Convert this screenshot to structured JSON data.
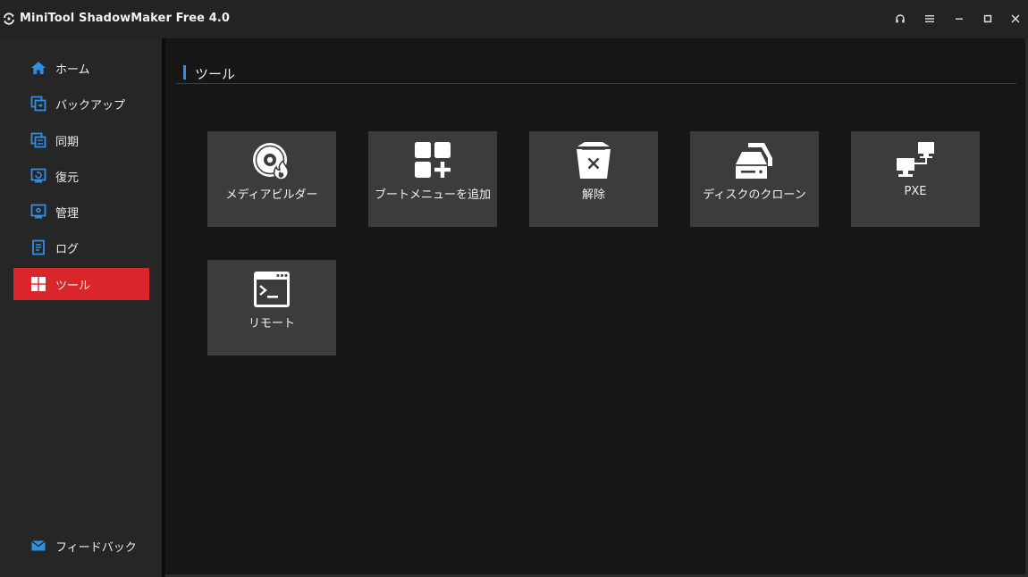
{
  "window": {
    "title": "MiniTool ShadowMaker Free 4.0"
  },
  "sidebar": {
    "items": [
      {
        "label": "ホーム",
        "icon": "home-icon"
      },
      {
        "label": "バックアップ",
        "icon": "backup-icon"
      },
      {
        "label": "同期",
        "icon": "sync-icon"
      },
      {
        "label": "復元",
        "icon": "restore-icon"
      },
      {
        "label": "管理",
        "icon": "manage-icon"
      },
      {
        "label": "ログ",
        "icon": "log-icon"
      },
      {
        "label": "ツール",
        "icon": "tools-icon",
        "active": true
      }
    ],
    "feedback": {
      "label": "フィードバック",
      "icon": "mail-icon"
    }
  },
  "main": {
    "title": "ツール",
    "tools": [
      {
        "label": "メディアビルダー",
        "icon": "media-builder-icon"
      },
      {
        "label": "ブートメニューを追加",
        "icon": "add-boot-menu-icon"
      },
      {
        "label": "解除",
        "icon": "unmount-icon"
      },
      {
        "label": "ディスクのクローン",
        "icon": "clone-disk-icon"
      },
      {
        "label": "PXE",
        "icon": "pxe-network-icon"
      },
      {
        "label": "リモート",
        "icon": "remote-terminal-icon"
      }
    ]
  },
  "colors": {
    "accent": "#d9262b",
    "nav_icon": "#2f8ee6",
    "section_marker": "#2f8ee6",
    "tile_bg": "#3c3c3c",
    "background": "#161616",
    "sidebar_bg": "#262626"
  }
}
